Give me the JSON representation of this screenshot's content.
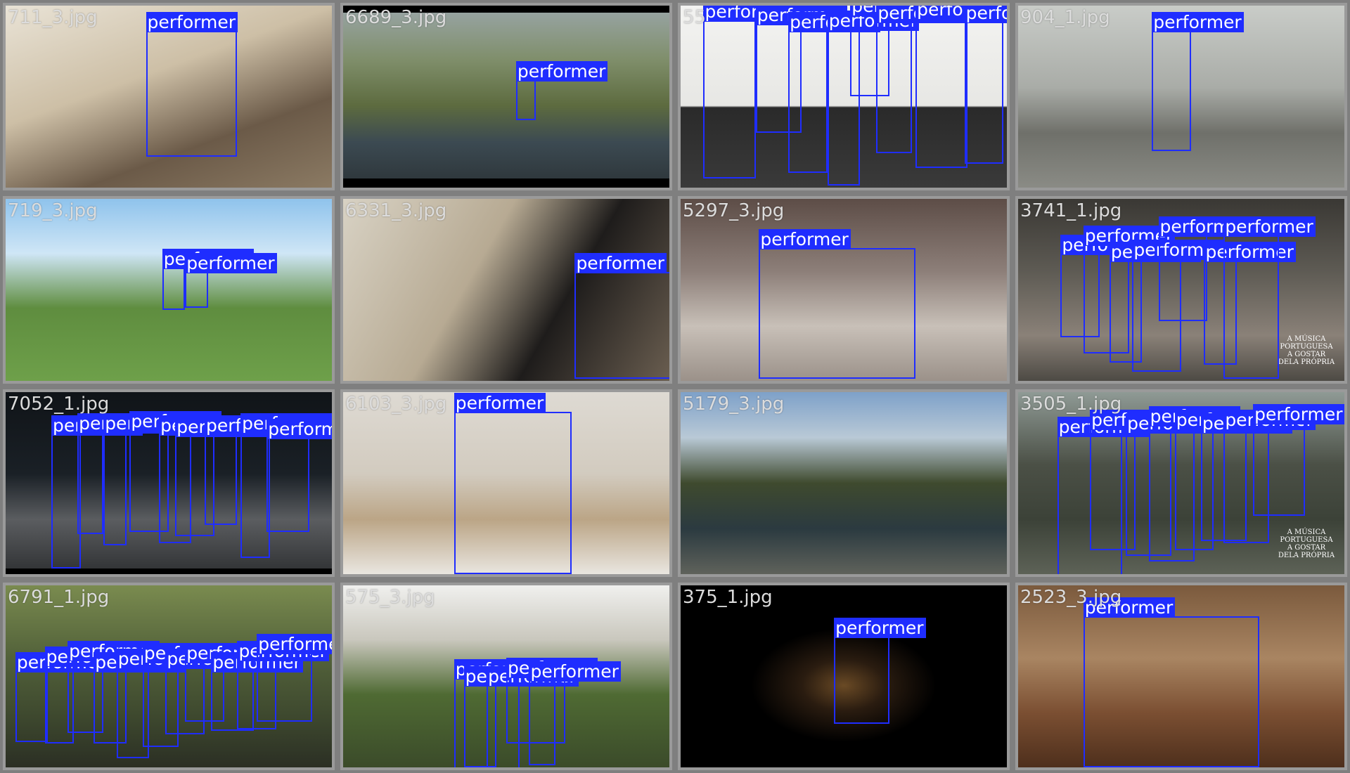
{
  "grid": {
    "tiles": [
      {
        "filename": "711_3.jpg",
        "detections": [
          {
            "label": "performer"
          }
        ]
      },
      {
        "filename": "6689_3.jpg",
        "detections": [
          {
            "label": "performer"
          }
        ]
      },
      {
        "filename": "55",
        "detections": [
          {
            "label": "performer"
          },
          {
            "label": "performer"
          },
          {
            "label": "performer"
          },
          {
            "label": "performer"
          },
          {
            "label": "performer"
          },
          {
            "label": "performer"
          },
          {
            "label": "performer"
          },
          {
            "label": "performer"
          }
        ]
      },
      {
        "filename": "904_1.jpg",
        "detections": [
          {
            "label": "performer"
          }
        ]
      },
      {
        "filename": "719_3.jpg",
        "detections": [
          {
            "label": "performer"
          },
          {
            "label": "performer"
          }
        ]
      },
      {
        "filename": "6331_3.jpg",
        "detections": [
          {
            "label": "performer"
          }
        ]
      },
      {
        "filename": "5297_3.jpg",
        "detections": [
          {
            "label": "performer"
          }
        ]
      },
      {
        "filename": "3741_1.jpg",
        "detections": [
          {
            "label": "performer"
          },
          {
            "label": "performer"
          },
          {
            "label": "performer"
          },
          {
            "label": "performer"
          },
          {
            "label": "performer"
          },
          {
            "label": "performer"
          },
          {
            "label": "performer"
          }
        ]
      },
      {
        "filename": "7052_1.jpg",
        "detections": [
          {
            "label": "performer"
          },
          {
            "label": "performer"
          },
          {
            "label": "performer"
          },
          {
            "label": "performer"
          },
          {
            "label": "performer"
          },
          {
            "label": "performer"
          },
          {
            "label": "performer"
          },
          {
            "label": "performer"
          },
          {
            "label": "performer"
          }
        ]
      },
      {
        "filename": "6103_3.jpg",
        "detections": [
          {
            "label": "performer"
          }
        ]
      },
      {
        "filename": "5179_3.jpg",
        "detections": []
      },
      {
        "filename": "3505_1.jpg",
        "detections": [
          {
            "label": "performer"
          },
          {
            "label": "performer"
          },
          {
            "label": "performer"
          },
          {
            "label": "performer"
          },
          {
            "label": "performer"
          },
          {
            "label": "performer"
          },
          {
            "label": "performer"
          },
          {
            "label": "performer"
          }
        ]
      },
      {
        "filename": "6791_1.jpg",
        "detections": [
          {
            "label": "performer"
          },
          {
            "label": "performer"
          },
          {
            "label": "performer"
          },
          {
            "label": "performer"
          },
          {
            "label": "performer"
          },
          {
            "label": "performer"
          },
          {
            "label": "performer"
          },
          {
            "label": "performer"
          },
          {
            "label": "performer"
          },
          {
            "label": "performer"
          },
          {
            "label": "performer"
          }
        ]
      },
      {
        "filename": "575_3.jpg",
        "detections": [
          {
            "label": "performer"
          },
          {
            "label": "performer"
          },
          {
            "label": "performer"
          },
          {
            "label": "performer"
          },
          {
            "label": "performer"
          }
        ]
      },
      {
        "filename": "375_1.jpg",
        "detections": [
          {
            "label": "performer"
          }
        ]
      },
      {
        "filename": "2523_3.jpg",
        "detections": [
          {
            "label": "performer"
          }
        ]
      }
    ]
  },
  "watermark_text": [
    "A MÚSICA",
    "PORTUGUESA",
    "A GOSTAR",
    "DELA PRÓPRIA"
  ],
  "colors": {
    "box": "#1f2dff",
    "label_text": "#ffffff",
    "grid_bg": "#7f7f7f",
    "filename_text": "#dcdcdc"
  }
}
